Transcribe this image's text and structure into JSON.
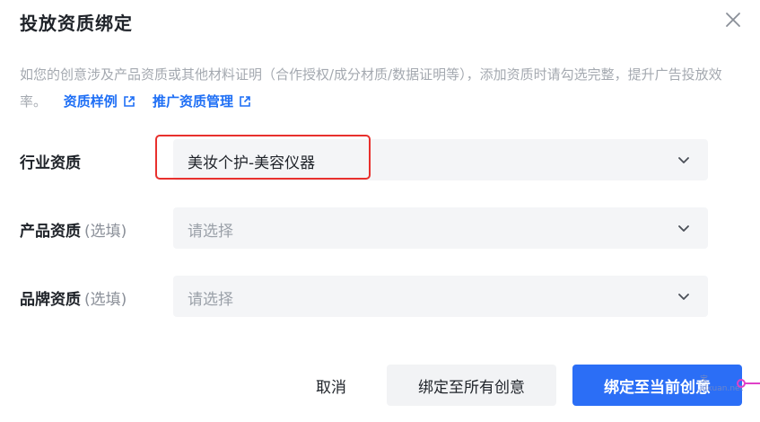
{
  "dialog": {
    "title": "投放资质绑定",
    "description": "如您的创意涉及产品资质或其他材料证明（合作授权/成分材质/数据证明等），添加资质时请勾选完整，提升广告投放效率。",
    "links": [
      {
        "label": "资质样例",
        "icon": "external-link-icon"
      },
      {
        "label": "推广资质管理",
        "icon": "external-link-icon"
      }
    ]
  },
  "fields": {
    "industry": {
      "label": "行业资质",
      "value": "美妆个护-美容仪器"
    },
    "product": {
      "label": "产品资质",
      "optional": "(选填)",
      "placeholder": "请选择"
    },
    "brand": {
      "label": "品牌资质",
      "optional": "(选填)",
      "placeholder": "请选择"
    }
  },
  "buttons": {
    "cancel": "取消",
    "bind_all": "绑定至所有创意",
    "bind_current": "绑定至当前创意"
  },
  "watermark": {
    "line1": "宝",
    "line2": "jdxuan.net"
  },
  "colors": {
    "primary": "#2b6ef6",
    "link": "#1f6ff5",
    "highlight_border": "#e8302d",
    "field_bg": "#f4f5f7",
    "pin": "#e040c8"
  }
}
